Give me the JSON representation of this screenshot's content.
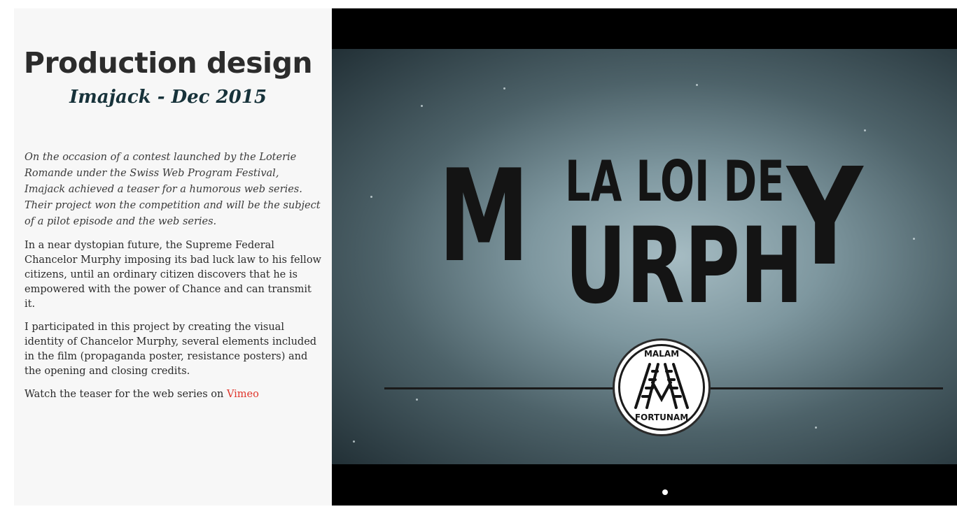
{
  "panel": {
    "title": "Production design",
    "subtitle": "Imajack - Dec 2015",
    "paragraphs": {
      "intro": "On the occasion of a contest launched by the Loterie Romande under the Swiss Web Program Festival, Imajack achieved a teaser for a humorous web series. Their project won the competition and will be the subject of a pilot episode and the web series.",
      "synopsis": "In a near dystopian future, the Supreme Federal Chancelor Murphy imposing its bad luck law to his fellow citizens, until an ordinary citizen discovers that he is empowered with the power of Chance and can transmit it.",
      "role": "I participated in this project by creating the visual identity of Chancelor Murphy, several elements included in the film (propaganda poster, resistance posters) and the opening and closing credits."
    },
    "watch_text": "Watch the teaser for the web series on ",
    "watch_link": "Vimeo",
    "link_color": "#e0342a"
  },
  "media": {
    "title_letter_m": "M",
    "title_top": "LA LOI DE",
    "title_bottom": "URPH",
    "title_letter_y": "Y",
    "seal_top": "MALAM",
    "seal_bottom": "FORTUNAM",
    "slide_count": 1,
    "active_slide": 1
  }
}
